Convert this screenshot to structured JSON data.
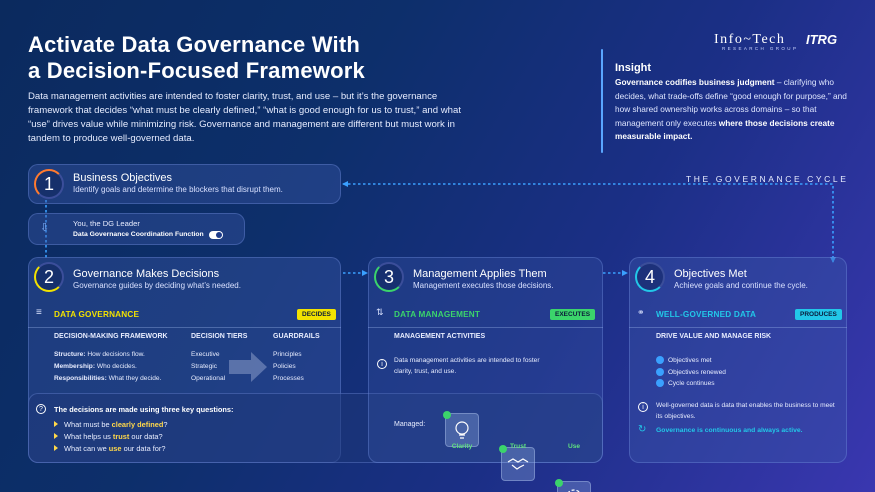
{
  "header": {
    "title_line1": "Activate Data Governance With",
    "title_line2": "a Decision-Focused Framework",
    "intro": "Data management activities are intended to foster clarity, trust, and use – but it’s the governance framework that decides “what must be clearly defined,” “what is good enough for us to trust,” and what “use” drives value while minimizing risk. Governance and management are different but must work in tandem to produce well-governed data."
  },
  "logo": {
    "main": "Info~Tech",
    "sub": "RESEARCH GROUP",
    "mark": "ITRG"
  },
  "insight": {
    "heading": "Insight",
    "lead": "Governance codifies business judgment",
    "body": " – clarifying who decides, what trade-offs define “good enough for purpose,” and how shared ownership works across domains – so that management only executes ",
    "tail": "where those decisions create measurable impact."
  },
  "cycle_label": "THE GOVERNANCE CYCLE",
  "step1": {
    "num": "1",
    "title": "Business Objectives",
    "sub": "Identify goals and determine the blockers that disrupt them."
  },
  "leader": {
    "line1": "You, the DG Leader",
    "line2": "Data Governance Coordination Function"
  },
  "step2": {
    "num": "2",
    "title": "Governance Makes Decisions",
    "sub": "Governance guides by deciding what’s needed.",
    "section": "DATA GOVERNANCE",
    "tag": "DECIDES",
    "col1": "DECISION-MAKING FRAMEWORK",
    "col2": "DECISION TIERS",
    "col3": "GUARDRAILS",
    "rows": [
      {
        "k": "Structure:",
        "v": " How decisions flow.",
        "tier": "Executive",
        "guard": "Principles"
      },
      {
        "k": "Membership:",
        "v": " Who decides.",
        "tier": "Strategic",
        "guard": "Policies"
      },
      {
        "k": "Responsibilities:",
        "v": " What they decide.",
        "tier": "Operational",
        "guard": "Processes"
      }
    ]
  },
  "questions": {
    "heading": "The decisions are made using three key questions:",
    "q1a": "What must be ",
    "q1b": "clearly defined",
    "q1c": "?",
    "q2a": "What helps us ",
    "q2b": "trust",
    "q2c": " our data?",
    "q3a": "What can we ",
    "q3b": "use",
    "q3c": " our data for?"
  },
  "step3": {
    "num": "3",
    "title": "Management Applies Them",
    "sub": "Management executes those decisions.",
    "section": "DATA MANAGEMENT",
    "tag": "EXECUTES",
    "col": "MANAGEMENT ACTIVITIES",
    "text": "Data management activities are intended to foster clarity, trust, and use.",
    "managed": "Managed:",
    "icons": [
      {
        "label": "Clarity",
        "icon": "lightbulb-icon"
      },
      {
        "label": "Trust",
        "icon": "handshake-icon"
      },
      {
        "label": "Use",
        "icon": "gear-icon"
      }
    ]
  },
  "step4": {
    "num": "4",
    "title": "Objectives Met",
    "sub": "Achieve goals and continue the cycle.",
    "section": "WELL-GOVERNED DATA",
    "tag": "PRODUCES",
    "col": "DRIVE VALUE AND MANAGE RISK",
    "checks": [
      "Objectives met",
      "Objectives renewed",
      "Cycle continues"
    ],
    "info": "Well-governed data is data that enables the business to meet its objectives.",
    "cycle": "Governance is continuous and always active."
  },
  "colors": {
    "decides": "#f2e200",
    "executes": "#3bd46b",
    "produces": "#22c7e8",
    "accent": "#5aa6ff"
  }
}
